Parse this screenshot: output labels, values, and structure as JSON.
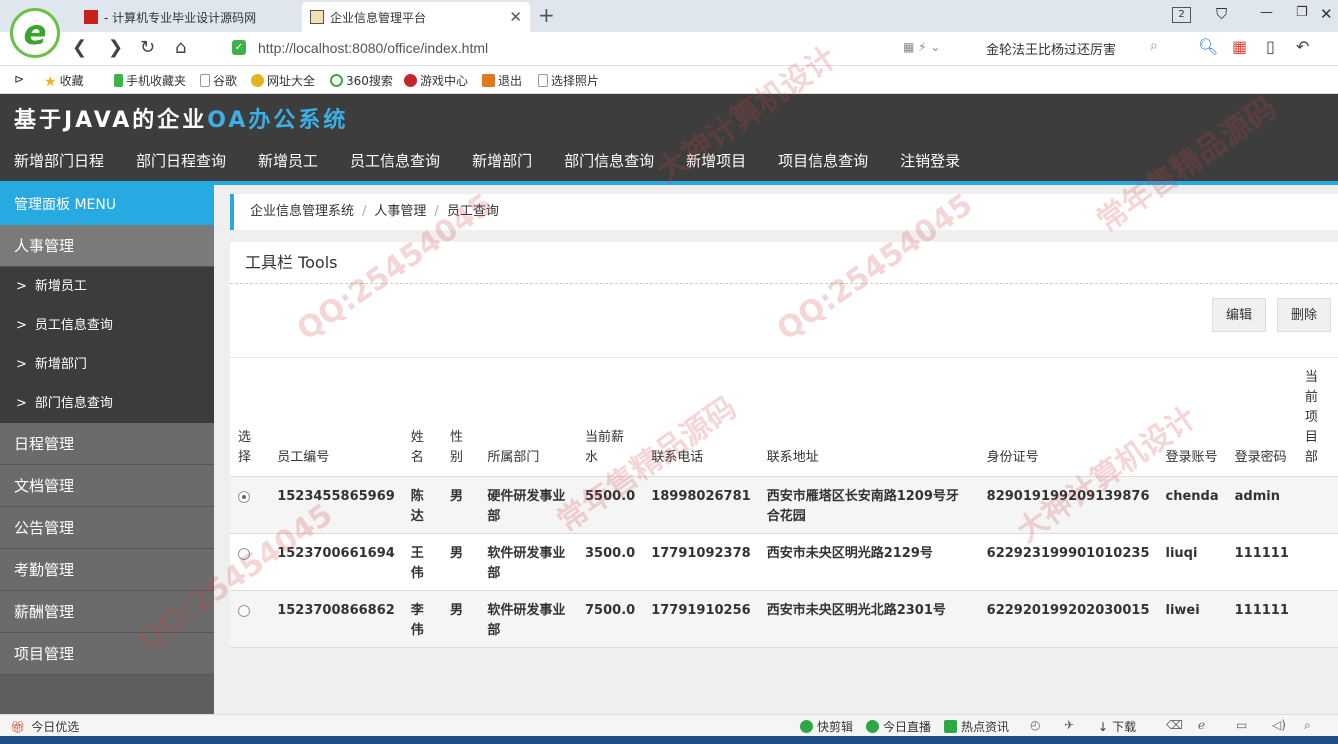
{
  "browser": {
    "tabs": [
      {
        "label": "- 计算机专业毕业设计源码网"
      },
      {
        "label": "企业信息管理平台"
      }
    ],
    "tab_count": "2",
    "address": "http://localhost:8080/office/index.html",
    "search_text": "金轮法王比杨过还厉害",
    "bookmarks": [
      "收藏",
      "手机收藏夹",
      "谷歌",
      "网址大全",
      "360搜索",
      "游戏中心",
      "退出",
      "选择照片"
    ]
  },
  "app": {
    "title_prefix": "基于JAVA的企业",
    "title_highlight": "OA办公系统",
    "main_nav": [
      "新增部门日程",
      "部门日程查询",
      "新增员工",
      "员工信息查询",
      "新增部门",
      "部门信息查询",
      "新增项目",
      "项目信息查询",
      "注销登录"
    ]
  },
  "sidebar": {
    "header": "管理面板 MENU",
    "active_group": "人事管理",
    "sub_items": [
      "新增员工",
      "员工信息查询",
      "新增部门",
      "部门信息查询"
    ],
    "groups": [
      "日程管理",
      "文档管理",
      "公告管理",
      "考勤管理",
      "薪酬管理",
      "项目管理"
    ]
  },
  "breadcrumb": [
    "企业信息管理系统",
    "人事管理",
    "员工查询"
  ],
  "panel": {
    "title": "工具栏 Tools",
    "edit_label": "编辑",
    "delete_label": "删除"
  },
  "table": {
    "headers": [
      "选择",
      "员工编号",
      "姓名",
      "性别",
      "所属部门",
      "当前薪水",
      "联系电话",
      "联系地址",
      "身份证号",
      "登录账号",
      "登录密码",
      "当前项目部"
    ],
    "rows": [
      {
        "checked": true,
        "id": "1523455865969",
        "name": "陈达",
        "gender": "男",
        "dept": "硬件研发事业部",
        "salary": "5500.0",
        "phone": "18998026781",
        "address": "西安市雁塔区长安南路1209号牙合花园",
        "idcard": "829019199209139876",
        "account": "chenda",
        "password": "admin",
        "project": ""
      },
      {
        "checked": false,
        "id": "1523700661694",
        "name": "王伟",
        "gender": "男",
        "dept": "软件研发事业部",
        "salary": "3500.0",
        "phone": "17791092378",
        "address": "西安市未央区明光路2129号",
        "idcard": "622923199901010235",
        "account": "liuqi",
        "password": "111111",
        "project": ""
      },
      {
        "checked": false,
        "id": "1523700866862",
        "name": "李伟",
        "gender": "男",
        "dept": "软件研发事业部",
        "salary": "7500.0",
        "phone": "17791910256",
        "address": "西安市未央区明光北路2301号",
        "idcard": "622920199202030015",
        "account": "liwei",
        "password": "111111",
        "project": ""
      }
    ]
  },
  "statusbar": {
    "left": "今日优选",
    "items": [
      "快剪辑",
      "今日直播",
      "热点资讯",
      "下载"
    ]
  },
  "watermark": [
    "QQ:25454045",
    "常年售精品源码",
    "大神计算机设计"
  ],
  "colors": {
    "accent": "#27a9e1",
    "header_bg": "#3d3d3d",
    "sidebar_bg": "#5f5f5f"
  }
}
